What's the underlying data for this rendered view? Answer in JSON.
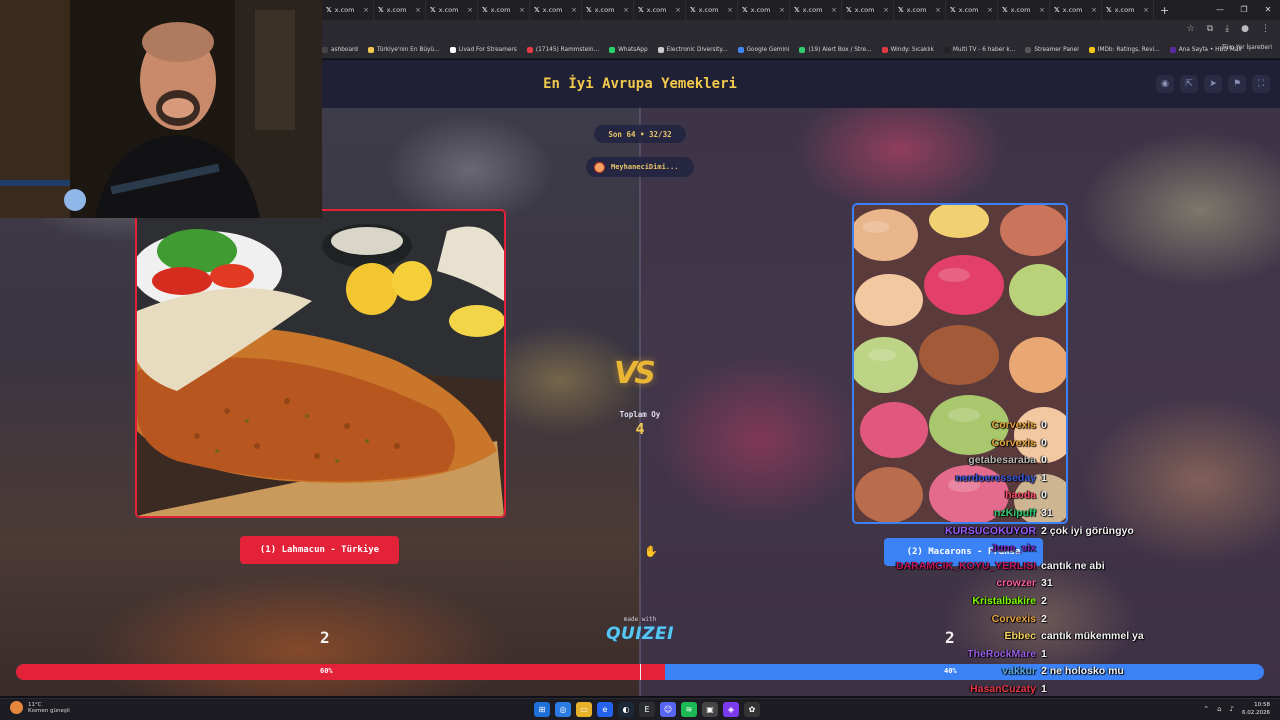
{
  "browser": {
    "tabs": [
      "x.com",
      "x.com",
      "x.com",
      "x.com",
      "x.com",
      "x.com",
      "x.com",
      "x.com",
      "x.com",
      "x.com",
      "x.com",
      "x.com",
      "x.com",
      "x.com",
      "x.com",
      "x.com"
    ],
    "bookmarks": [
      "ashboard",
      "Türkiye'nin En Büyü...",
      "Livad For Streamers",
      "(17145) Rammstein...",
      "WhatsApp",
      "Electronic Diversity...",
      "Google Gemini",
      "(19) Alert Box / Stre...",
      "Windy: Sıcaklık",
      "Multi TV - 6 haber k...",
      "Streamer Panel",
      "IMDb: Ratings, Revi...",
      "Ana Sayfa • HBO Max"
    ],
    "bookmarks_right": "Tüm Yer İşaretleri"
  },
  "quiz": {
    "title": "En İyi Avrupa Yemekleri",
    "round": "Son 64 • 32/32",
    "user": "MeyhaneciDimi...",
    "vs": "VS",
    "total_votes_label": "Toplam Oy",
    "total_votes": "4",
    "left": {
      "label": "(1) Lahmacun - Türkiye",
      "score": "2",
      "percent_label": "60%",
      "share": 0.52
    },
    "right": {
      "label": "(2) Macarons - Fransa",
      "score": "2",
      "percent_label": "40%"
    },
    "made_with": "made with",
    "brand": "QUIZEI"
  },
  "chat": [
    {
      "user": "Corvexis",
      "msg": "0",
      "color": "#e8a33d"
    },
    {
      "user": "Corvexis",
      "msg": "0",
      "color": "#e8a33d"
    },
    {
      "user": "getabesaraba",
      "msg": "0",
      "color": "#b8b8b8"
    },
    {
      "user": "nerdoeresseday",
      "msg": "1",
      "color": "#3b5bdb"
    },
    {
      "user": "haoda",
      "msg": "0",
      "color": "#ff4d6d"
    },
    {
      "user": "nzKipuff",
      "msg": "31",
      "color": "#2ecc71"
    },
    {
      "user": "KURSUCOKUYOR",
      "msg": "2 çok iyi görüngyo",
      "color": "#9b59ff"
    },
    {
      "user": "June_six",
      "msg": "",
      "color": "#7b2cbf"
    },
    {
      "user": "DARAMCIK_KOYU_YERLISI",
      "msg": "cantık ne abi",
      "color": "#c2185b"
    },
    {
      "user": "crowzer",
      "msg": "31",
      "color": "#ff5fa2"
    },
    {
      "user": "Kristalbakire",
      "msg": "2",
      "color": "#7cfc00"
    },
    {
      "user": "Corvexis",
      "msg": "2",
      "color": "#e8a33d"
    },
    {
      "user": "Ebbec",
      "msg": "cantık mükemmel ya",
      "color": "#f4d35e"
    },
    {
      "user": "TheRockMare",
      "msg": "1",
      "color": "#9b5de5"
    },
    {
      "user": "vakkur",
      "msg": "2 ne holosko mu",
      "color": "#5dade2"
    },
    {
      "user": "HasanCuzaty",
      "msg": "1",
      "color": "#e63946"
    }
  ],
  "taskbar": {
    "temp": "11°C",
    "weather": "Kısmen güneşli",
    "time": "10:58",
    "date": "6.02.2026"
  }
}
